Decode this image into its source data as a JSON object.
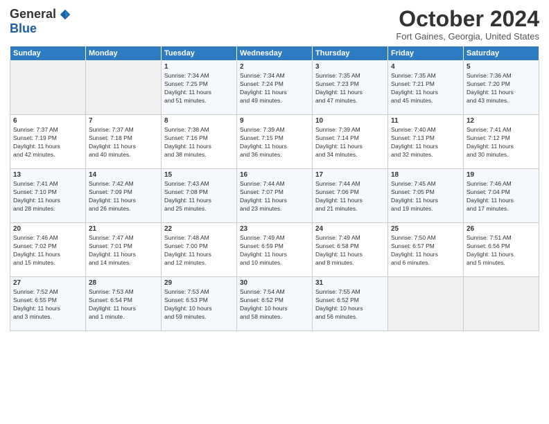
{
  "header": {
    "logo_general": "General",
    "logo_blue": "Blue",
    "month_title": "October 2024",
    "location": "Fort Gaines, Georgia, United States"
  },
  "weekdays": [
    "Sunday",
    "Monday",
    "Tuesday",
    "Wednesday",
    "Thursday",
    "Friday",
    "Saturday"
  ],
  "weeks": [
    [
      {
        "day": "",
        "info": ""
      },
      {
        "day": "",
        "info": ""
      },
      {
        "day": "1",
        "info": "Sunrise: 7:34 AM\nSunset: 7:25 PM\nDaylight: 11 hours\nand 51 minutes."
      },
      {
        "day": "2",
        "info": "Sunrise: 7:34 AM\nSunset: 7:24 PM\nDaylight: 11 hours\nand 49 minutes."
      },
      {
        "day": "3",
        "info": "Sunrise: 7:35 AM\nSunset: 7:23 PM\nDaylight: 11 hours\nand 47 minutes."
      },
      {
        "day": "4",
        "info": "Sunrise: 7:35 AM\nSunset: 7:21 PM\nDaylight: 11 hours\nand 45 minutes."
      },
      {
        "day": "5",
        "info": "Sunrise: 7:36 AM\nSunset: 7:20 PM\nDaylight: 11 hours\nand 43 minutes."
      }
    ],
    [
      {
        "day": "6",
        "info": "Sunrise: 7:37 AM\nSunset: 7:19 PM\nDaylight: 11 hours\nand 42 minutes."
      },
      {
        "day": "7",
        "info": "Sunrise: 7:37 AM\nSunset: 7:18 PM\nDaylight: 11 hours\nand 40 minutes."
      },
      {
        "day": "8",
        "info": "Sunrise: 7:38 AM\nSunset: 7:16 PM\nDaylight: 11 hours\nand 38 minutes."
      },
      {
        "day": "9",
        "info": "Sunrise: 7:39 AM\nSunset: 7:15 PM\nDaylight: 11 hours\nand 36 minutes."
      },
      {
        "day": "10",
        "info": "Sunrise: 7:39 AM\nSunset: 7:14 PM\nDaylight: 11 hours\nand 34 minutes."
      },
      {
        "day": "11",
        "info": "Sunrise: 7:40 AM\nSunset: 7:13 PM\nDaylight: 11 hours\nand 32 minutes."
      },
      {
        "day": "12",
        "info": "Sunrise: 7:41 AM\nSunset: 7:12 PM\nDaylight: 11 hours\nand 30 minutes."
      }
    ],
    [
      {
        "day": "13",
        "info": "Sunrise: 7:41 AM\nSunset: 7:10 PM\nDaylight: 11 hours\nand 28 minutes."
      },
      {
        "day": "14",
        "info": "Sunrise: 7:42 AM\nSunset: 7:09 PM\nDaylight: 11 hours\nand 26 minutes."
      },
      {
        "day": "15",
        "info": "Sunrise: 7:43 AM\nSunset: 7:08 PM\nDaylight: 11 hours\nand 25 minutes."
      },
      {
        "day": "16",
        "info": "Sunrise: 7:44 AM\nSunset: 7:07 PM\nDaylight: 11 hours\nand 23 minutes."
      },
      {
        "day": "17",
        "info": "Sunrise: 7:44 AM\nSunset: 7:06 PM\nDaylight: 11 hours\nand 21 minutes."
      },
      {
        "day": "18",
        "info": "Sunrise: 7:45 AM\nSunset: 7:05 PM\nDaylight: 11 hours\nand 19 minutes."
      },
      {
        "day": "19",
        "info": "Sunrise: 7:46 AM\nSunset: 7:04 PM\nDaylight: 11 hours\nand 17 minutes."
      }
    ],
    [
      {
        "day": "20",
        "info": "Sunrise: 7:46 AM\nSunset: 7:02 PM\nDaylight: 11 hours\nand 15 minutes."
      },
      {
        "day": "21",
        "info": "Sunrise: 7:47 AM\nSunset: 7:01 PM\nDaylight: 11 hours\nand 14 minutes."
      },
      {
        "day": "22",
        "info": "Sunrise: 7:48 AM\nSunset: 7:00 PM\nDaylight: 11 hours\nand 12 minutes."
      },
      {
        "day": "23",
        "info": "Sunrise: 7:49 AM\nSunset: 6:59 PM\nDaylight: 11 hours\nand 10 minutes."
      },
      {
        "day": "24",
        "info": "Sunrise: 7:49 AM\nSunset: 6:58 PM\nDaylight: 11 hours\nand 8 minutes."
      },
      {
        "day": "25",
        "info": "Sunrise: 7:50 AM\nSunset: 6:57 PM\nDaylight: 11 hours\nand 6 minutes."
      },
      {
        "day": "26",
        "info": "Sunrise: 7:51 AM\nSunset: 6:56 PM\nDaylight: 11 hours\nand 5 minutes."
      }
    ],
    [
      {
        "day": "27",
        "info": "Sunrise: 7:52 AM\nSunset: 6:55 PM\nDaylight: 11 hours\nand 3 minutes."
      },
      {
        "day": "28",
        "info": "Sunrise: 7:53 AM\nSunset: 6:54 PM\nDaylight: 11 hours\nand 1 minute."
      },
      {
        "day": "29",
        "info": "Sunrise: 7:53 AM\nSunset: 6:53 PM\nDaylight: 10 hours\nand 59 minutes."
      },
      {
        "day": "30",
        "info": "Sunrise: 7:54 AM\nSunset: 6:52 PM\nDaylight: 10 hours\nand 58 minutes."
      },
      {
        "day": "31",
        "info": "Sunrise: 7:55 AM\nSunset: 6:52 PM\nDaylight: 10 hours\nand 56 minutes."
      },
      {
        "day": "",
        "info": ""
      },
      {
        "day": "",
        "info": ""
      }
    ]
  ]
}
